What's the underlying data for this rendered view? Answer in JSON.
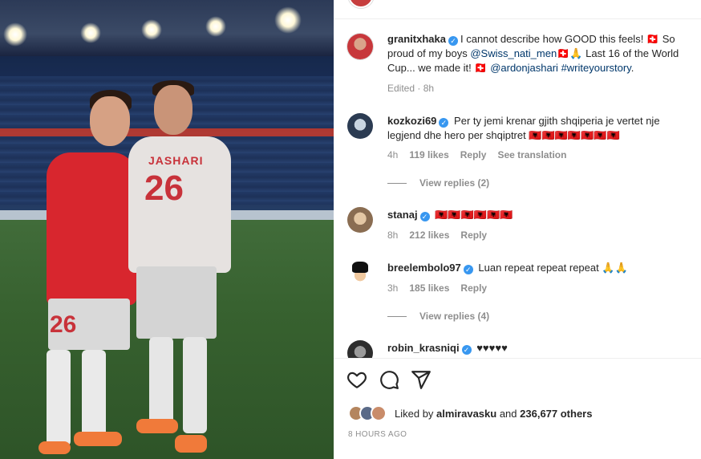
{
  "photo": {
    "jersey_name": "JASHARI",
    "jersey_number_left": "26",
    "jersey_number_right": "26"
  },
  "post": {
    "author": "granitxhaka",
    "caption_parts": {
      "a": "I cannot describe how GOOD this feels! 🇨🇭 So proud of my boys ",
      "mention1": "@Swiss_nati_men",
      "b": "🇨🇭🙏 Last 16 of the World Cup... we made it! 🇨🇭 ",
      "mention2": "@ardonjashari",
      "c": " ",
      "hashtag": "#writeyourstory",
      "d": "."
    },
    "meta": "Edited · 8h"
  },
  "comments": [
    {
      "username": "kozkozi69",
      "text": "Per ty jemi krenar gjith shqiperia je vertet nje legjend dhe hero per shqiptret 🇦🇱🇦🇱🇦🇱🇦🇱🇦🇱🇦🇱🇦🇱",
      "time": "4h",
      "likes": "119 likes",
      "reply": "Reply",
      "translate": "See translation",
      "view_replies": "View replies (2)"
    },
    {
      "username": "stanaj",
      "text": "🇦🇱🇦🇱🇦🇱🇦🇱🇦🇱🇦🇱",
      "time": "8h",
      "likes": "212 likes",
      "reply": "Reply"
    },
    {
      "username": "breelembolo97",
      "text": "Luan repeat repeat repeat 🙏🙏",
      "time": "3h",
      "likes": "185 likes",
      "reply": "Reply",
      "view_replies": "View replies (4)"
    },
    {
      "username": "robin_krasniqi",
      "text": "♥♥♥♥♥"
    }
  ],
  "actions": {
    "like_icon": "heart-icon",
    "comment_icon": "comment-icon",
    "share_icon": "share-icon"
  },
  "likes": {
    "prefix": "Liked by ",
    "user": "almiravasku",
    "middle": " and ",
    "others": "236,677 others"
  },
  "timestamp": "8 HOURS AGO",
  "colors": {
    "verified": "#3897f0",
    "mention": "#00376b",
    "muted": "#8e8e8e",
    "text": "#262626"
  }
}
